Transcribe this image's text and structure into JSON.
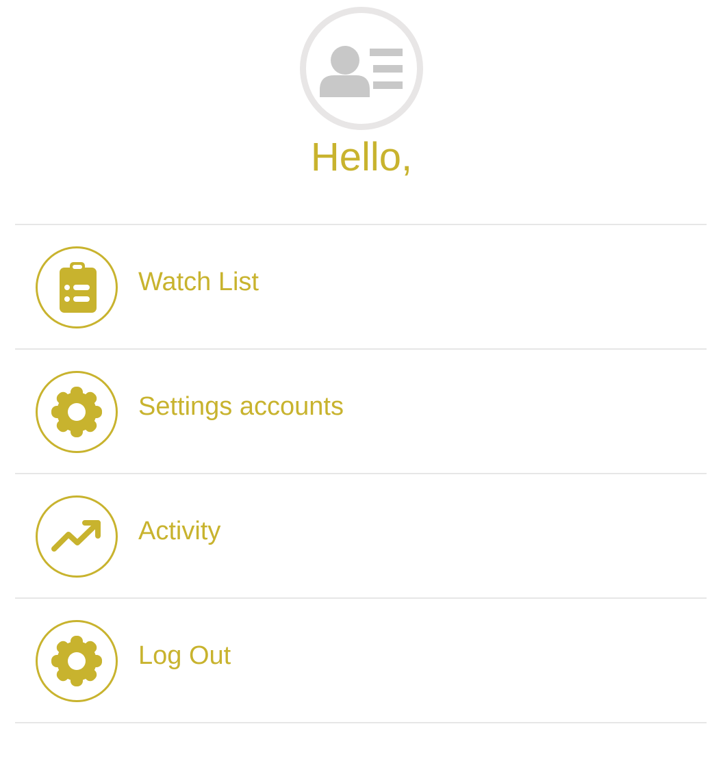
{
  "app": {
    "accent_color": "#c8b32e",
    "avatar_ring_color": "#e8e6e6",
    "avatar_icon_color": "#c8c8c8"
  },
  "profile": {
    "avatar_icon": "contact-card-icon",
    "greeting": "Hello,"
  },
  "menu": {
    "items": [
      {
        "label": "Watch List",
        "icon": "clipboard-list-icon"
      },
      {
        "label": "Settings accounts",
        "icon": "gear-icon"
      },
      {
        "label": "Activity",
        "icon": "trending-up-icon"
      },
      {
        "label": "Log Out",
        "icon": "gear-icon"
      }
    ]
  }
}
